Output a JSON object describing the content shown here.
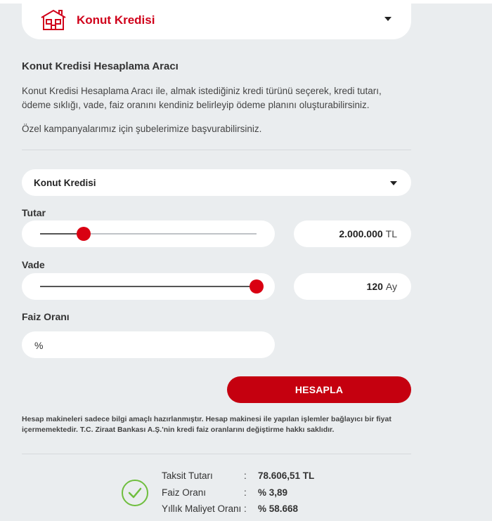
{
  "header": {
    "title": "Konut Kredisi",
    "icon": "house-icon"
  },
  "calculator": {
    "title": "Konut Kredisi Hesaplama Aracı",
    "description": "Konut Kredisi Hesaplama Aracı ile, almak istediğiniz kredi türünü seçerek, kredi tutarı, ödeme sıklığı, vade, faiz oranını kendiniz belirleyip ödeme planını oluşturabilirsiniz.",
    "note": "Özel kampanyalarımız için şubelerimize başvurabilirsiniz."
  },
  "loan_type": {
    "selected": "Konut Kredisi"
  },
  "amount": {
    "label": "Tutar",
    "value": "2.000.000",
    "unit": "TL",
    "slider_fraction": 0.2
  },
  "term": {
    "label": "Vade",
    "value": "120",
    "unit": "Ay",
    "slider_fraction": 1.0
  },
  "rate": {
    "label": "Faiz Oranı",
    "prefix": "%",
    "value": ""
  },
  "button": {
    "label": "HESAPLA"
  },
  "disclaimer": "Hesap makineleri sadece bilgi amaçlı hazırlanmıştır. Hesap makinesi ile yapılan işlemler bağlayıcı bir fiyat içermemektedir. T.C. Ziraat Bankası A.Ş.'nin kredi faiz oranlarını değiştirme hakkı saklıdır.",
  "results": {
    "separator": ":",
    "rows": [
      {
        "key": "Taksit Tutarı",
        "value": "78.606,51 TL"
      },
      {
        "key": "Faiz Oranı",
        "value": "% 3,89"
      },
      {
        "key": "Yıllık Maliyet Oranı",
        "value": "% 58.668"
      }
    ]
  },
  "colors": {
    "brand_red": "#c5000f",
    "success_green": "#6fbe3e",
    "background": "#eaedef"
  }
}
